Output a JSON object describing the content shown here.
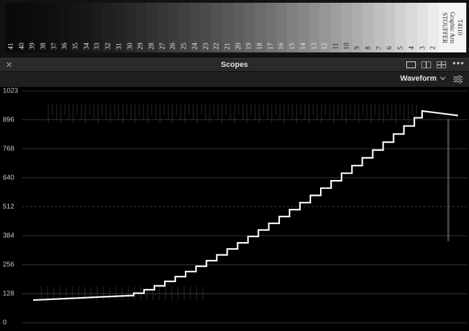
{
  "stepwedge": {
    "steps": [
      "41",
      "40",
      "39",
      "38",
      "37",
      "36",
      "35",
      "34",
      "33",
      "32",
      "31",
      "30",
      "29",
      "28",
      "27",
      "26",
      "25",
      "24",
      "23",
      "22",
      "21",
      "20",
      "19",
      "18",
      "17",
      "16",
      "15",
      "14",
      "13",
      "12",
      "11",
      "10",
      "9",
      "8",
      "7",
      "6",
      "5",
      "4",
      "3",
      "2"
    ],
    "brand_lines": [
      "STOUFFER",
      "Graphic Arts",
      "T4110"
    ]
  },
  "header": {
    "close_icon": "close-icon",
    "title": "Scopes",
    "layout_icons": [
      "single-layout-icon",
      "dual-layout-icon",
      "quad-layout-icon"
    ],
    "more_icon": "more-icon"
  },
  "toolbar": {
    "scope_type": "Waveform",
    "settings_icon": "settings-icon"
  },
  "waveform": {
    "y_ticks": [
      "1023",
      "896",
      "768",
      "640",
      "512",
      "384",
      "256",
      "128",
      "0"
    ],
    "grid_color": "#8a7a60",
    "trace_color": "#ffffff"
  }
}
